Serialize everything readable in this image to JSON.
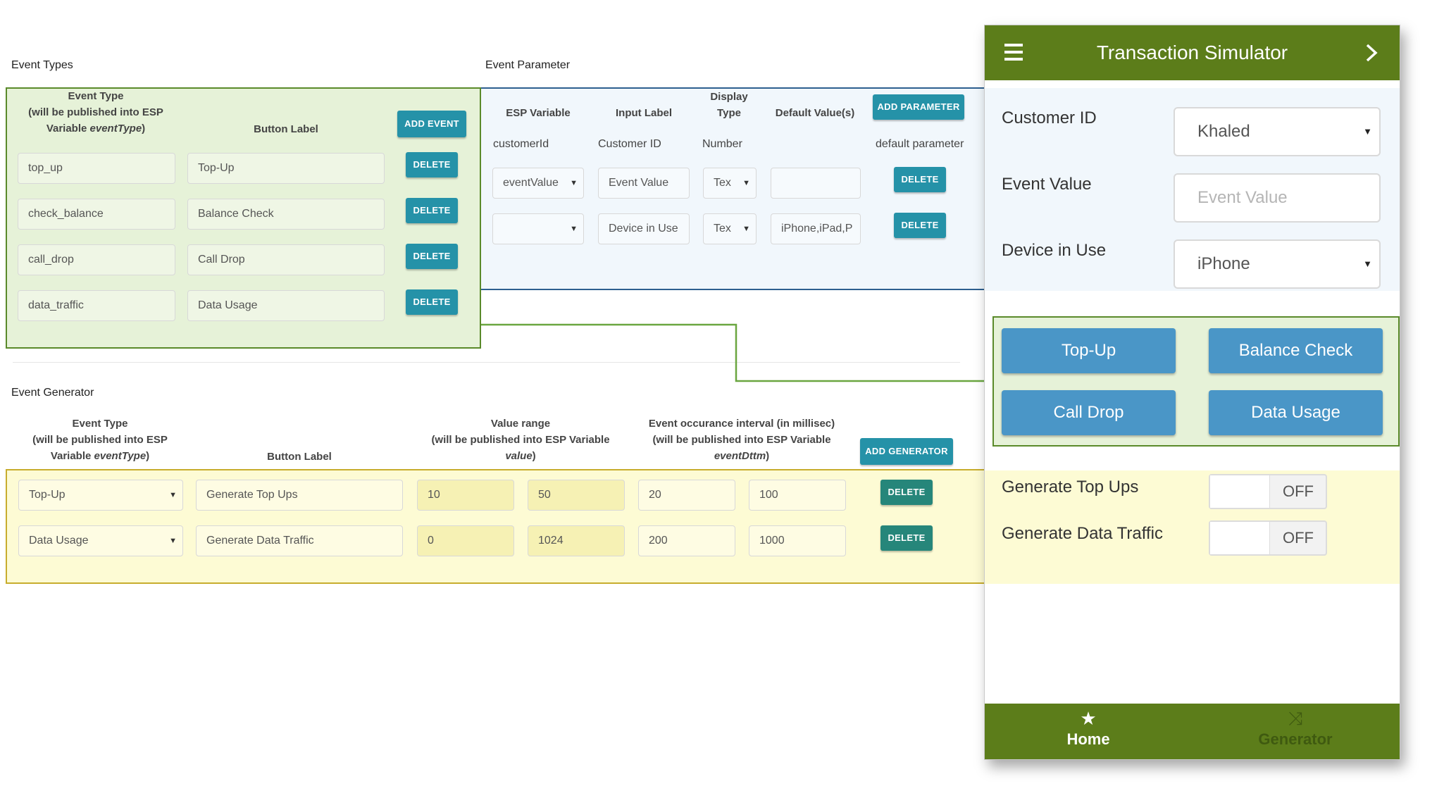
{
  "event_types": {
    "section_title": "Event Types",
    "header_event_type_line1": "Event Type",
    "header_event_type_line2": "(will be published into ESP",
    "header_event_type_line3": "Variable ",
    "header_event_type_var": "eventType",
    "header_event_type_close": ")",
    "header_button_label": "Button Label",
    "add_label": "ADD EVENT",
    "delete_label": "DELETE",
    "rows": [
      {
        "type": "top_up",
        "label": "Top-Up"
      },
      {
        "type": "check_balance",
        "label": "Balance Check"
      },
      {
        "type": "call_drop",
        "label": "Call Drop"
      },
      {
        "type": "data_traffic",
        "label": "Data Usage"
      }
    ]
  },
  "event_parameter": {
    "section_title": "Event Parameter",
    "col_esp_variable": "ESP Variable",
    "col_input_label": "Input Label",
    "col_display_type_line1": "Display",
    "col_display_type_line2": "Type",
    "col_default_values": "Default Value(s)",
    "add_label": "ADD PARAMETER",
    "delete_label": "DELETE",
    "static_row": {
      "esp_variable": "customerId",
      "input_label": "Customer ID",
      "display_type": "Number",
      "default": "default parameter"
    },
    "rows": [
      {
        "esp_variable": "eventValue",
        "input_label": "Event Value",
        "display_type": "Tex",
        "default": ""
      },
      {
        "esp_variable": "",
        "input_label": "Device in Use",
        "display_type": "Tex",
        "default": "iPhone,iPad,P"
      }
    ]
  },
  "event_generator": {
    "section_title": "Event Generator",
    "header_event_type_line1": "Event Type",
    "header_event_type_line2": "(will be published into ESP",
    "header_event_type_line3": "Variable ",
    "header_event_type_var": "eventType",
    "header_event_type_close": ")",
    "header_button_label": "Button Label",
    "header_value_range_line1": "Value range",
    "header_value_range_line2": "(will be published into ESP Variable",
    "header_value_range_var": "value",
    "header_value_range_close": ")",
    "header_interval_line1": "Event occurance interval (in millisec)",
    "header_interval_line2": "(will be published into ESP Variable",
    "header_interval_var": "eventDttm",
    "header_interval_close": ")",
    "add_label": "ADD GENERATOR",
    "delete_label": "DELETE",
    "rows": [
      {
        "event_type": "Top-Up",
        "label": "Generate Top Ups",
        "min": "10",
        "max": "50",
        "int_min": "20",
        "int_max": "100"
      },
      {
        "event_type": "Data Usage",
        "label": "Generate Data Traffic",
        "min": "0",
        "max": "1024",
        "int_min": "200",
        "int_max": "1000"
      }
    ]
  },
  "phone": {
    "title": "Transaction Simulator",
    "menu_icon": "hamburger-icon",
    "next_icon": "chevron-right-icon",
    "customer_id_label": "Customer ID",
    "customer_id_value": "Khaled",
    "event_value_label": "Event Value",
    "event_value_placeholder": "Event Value",
    "device_label": "Device in Use",
    "device_value": "iPhone",
    "buttons": [
      "Top-Up",
      "Balance Check",
      "Call Drop",
      "Data Usage"
    ],
    "generators": [
      {
        "label": "Generate Top Ups",
        "state": "OFF"
      },
      {
        "label": "Generate Data Traffic",
        "state": "OFF"
      }
    ],
    "tabs": [
      {
        "label": "Home",
        "icon": "star-icon"
      },
      {
        "label": "Generator",
        "icon": "shuffle-icon"
      }
    ]
  },
  "colors": {
    "green_region": "#e6f2d8",
    "green_border": "#5a8a2a",
    "blue_region": "#f1f7fc",
    "blue_border": "#2d5f8f",
    "yellow_region": "#fdfbd4",
    "yellow_border": "#c8ad2d",
    "phone_bar": "#5c7d1a",
    "phone_button": "#4a96c7",
    "teal_button": "#2592a8"
  }
}
